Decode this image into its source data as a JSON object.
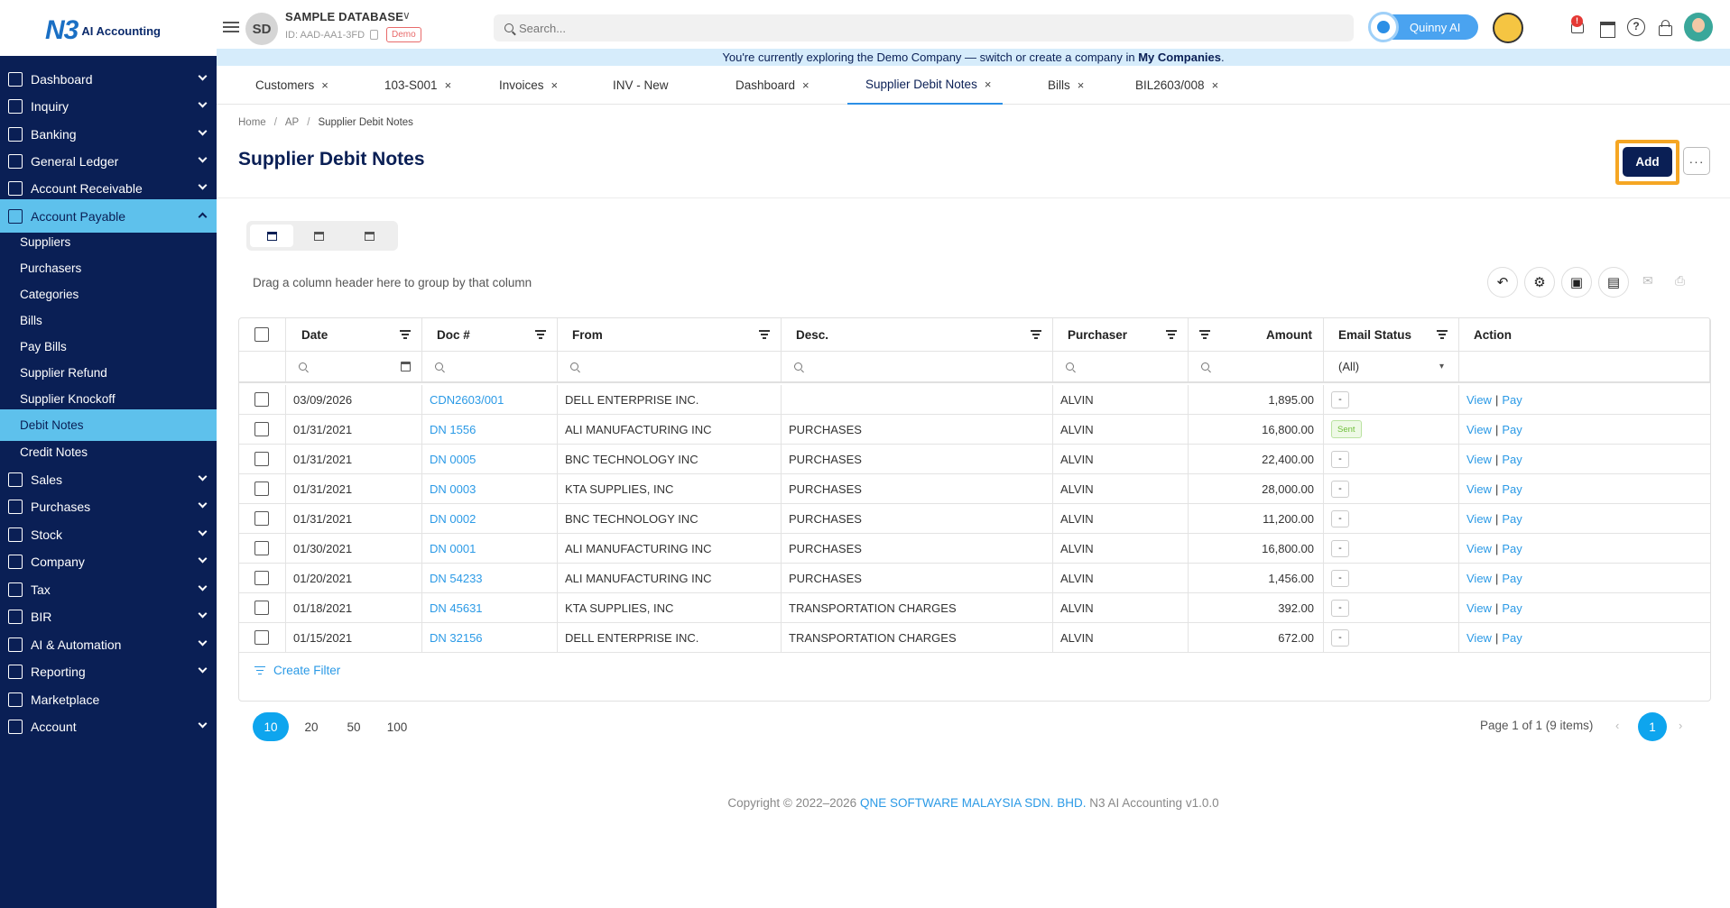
{
  "app": {
    "logo_mark": "N3",
    "logo_text": "AI Accounting"
  },
  "database": {
    "initials": "SD",
    "name": "SAMPLE DATABASE",
    "id": "ID: AAD-AA1-3FD",
    "badge": "Demo"
  },
  "search": {
    "placeholder": "Search..."
  },
  "assistant": {
    "label": "Quinny AI"
  },
  "notifications": {
    "count": "!"
  },
  "infobar": {
    "text": "You're currently exploring the Demo Company — switch or create a company in ",
    "link": "My Companies",
    "suffix": "."
  },
  "sidebar": {
    "items": [
      {
        "label": "Dashboard",
        "icon": "dashboard-icon"
      },
      {
        "label": "Inquiry",
        "icon": "inquiry-icon"
      },
      {
        "label": "Banking",
        "icon": "bank-icon"
      },
      {
        "label": "General Ledger",
        "icon": "ledger-icon"
      },
      {
        "label": "Account Receivable",
        "icon": "receivable-icon"
      },
      {
        "label": "Account Payable",
        "icon": "payable-icon"
      },
      {
        "label": "Sales",
        "icon": "sales-icon"
      },
      {
        "label": "Purchases",
        "icon": "purchases-icon"
      },
      {
        "label": "Stock",
        "icon": "stock-icon"
      },
      {
        "label": "Company",
        "icon": "company-icon"
      },
      {
        "label": "Tax",
        "icon": "tax-icon"
      },
      {
        "label": "BIR",
        "icon": "bir-icon"
      },
      {
        "label": "AI & Automation",
        "icon": "ai-icon"
      },
      {
        "label": "Reporting",
        "icon": "reporting-icon"
      },
      {
        "label": "Marketplace",
        "icon": "marketplace-icon"
      },
      {
        "label": "Account",
        "icon": "account-icon"
      }
    ],
    "payable_sub": [
      "Suppliers",
      "Purchasers",
      "Categories",
      "Bills",
      "Pay Bills",
      "Supplier Refund",
      "Supplier Knockoff",
      "Debit Notes",
      "Credit Notes"
    ]
  },
  "tabs": [
    {
      "label": "Customers"
    },
    {
      "label": "103-S001"
    },
    {
      "label": "Invoices"
    },
    {
      "label": "INV - New"
    },
    {
      "label": "Dashboard"
    },
    {
      "label": "Supplier Debit Notes"
    },
    {
      "label": "Bills"
    },
    {
      "label": "BIL2603/008"
    }
  ],
  "tab_close": "×",
  "breadcrumb": [
    "Home",
    "AP",
    "Supplier Debit Notes"
  ],
  "breadcrumb_sep": "/",
  "page": {
    "title": "Supplier Debit Notes",
    "add_label": "Add",
    "more_label": "···",
    "group_hint": "Drag a column header here to group by that column"
  },
  "grid": {
    "columns": [
      "Date",
      "Doc #",
      "From",
      "Desc.",
      "Purchaser",
      "Amount",
      "Email Status",
      "Action"
    ],
    "email_filter": "(All)",
    "rows": [
      {
        "date": "03/09/2026",
        "doc": "CDN2603/001",
        "from": "DELL ENTERPRISE INC.",
        "desc": "",
        "purchaser": "ALVIN",
        "amount": "1,895.00",
        "email": "-"
      },
      {
        "date": "01/31/2021",
        "doc": "DN 1556",
        "from": "ALI MANUFACTURING INC",
        "desc": "PURCHASES",
        "purchaser": "ALVIN",
        "amount": "16,800.00",
        "email": "Sent"
      },
      {
        "date": "01/31/2021",
        "doc": "DN 0005",
        "from": "BNC TECHNOLOGY INC",
        "desc": "PURCHASES",
        "purchaser": "ALVIN",
        "amount": "22,400.00",
        "email": "-"
      },
      {
        "date": "01/31/2021",
        "doc": "DN 0003",
        "from": "KTA SUPPLIES, INC",
        "desc": "PURCHASES",
        "purchaser": "ALVIN",
        "amount": "28,000.00",
        "email": "-"
      },
      {
        "date": "01/31/2021",
        "doc": "DN 0002",
        "from": "BNC TECHNOLOGY INC",
        "desc": "PURCHASES",
        "purchaser": "ALVIN",
        "amount": "11,200.00",
        "email": "-"
      },
      {
        "date": "01/30/2021",
        "doc": "DN 0001",
        "from": "ALI MANUFACTURING INC",
        "desc": "PURCHASES",
        "purchaser": "ALVIN",
        "amount": "16,800.00",
        "email": "-"
      },
      {
        "date": "01/20/2021",
        "doc": "DN 54233",
        "from": "ALI MANUFACTURING INC",
        "desc": "PURCHASES",
        "purchaser": "ALVIN",
        "amount": "1,456.00",
        "email": "-"
      },
      {
        "date": "01/18/2021",
        "doc": "DN 45631",
        "from": "KTA SUPPLIES, INC",
        "desc": "TRANSPORTATION CHARGES",
        "purchaser": "ALVIN",
        "amount": "392.00",
        "email": "-"
      },
      {
        "date": "01/15/2021",
        "doc": "DN 32156",
        "from": "DELL ENTERPRISE INC.",
        "desc": "TRANSPORTATION CHARGES",
        "purchaser": "ALVIN",
        "amount": "672.00",
        "email": "-"
      }
    ],
    "action_view": "View",
    "action_pay": "Pay",
    "action_sep": "|",
    "create_filter": "Create Filter"
  },
  "pager": {
    "sizes": [
      "10",
      "20",
      "50",
      "100"
    ],
    "info": "Page 1 of 1 (9 items)",
    "current": "1",
    "prev": "‹",
    "next": "›"
  },
  "footer": {
    "prefix": "Copyright © 2022–2026 ",
    "company": "QNE SOFTWARE MALAYSIA SDN. BHD.",
    "suffix": " N3 AI Accounting v1.0.0"
  },
  "colors": {
    "sidebar": "#0a1f55",
    "accent": "#5ec1ec",
    "link": "#2b9ae6",
    "highlight": "#f5a623"
  }
}
